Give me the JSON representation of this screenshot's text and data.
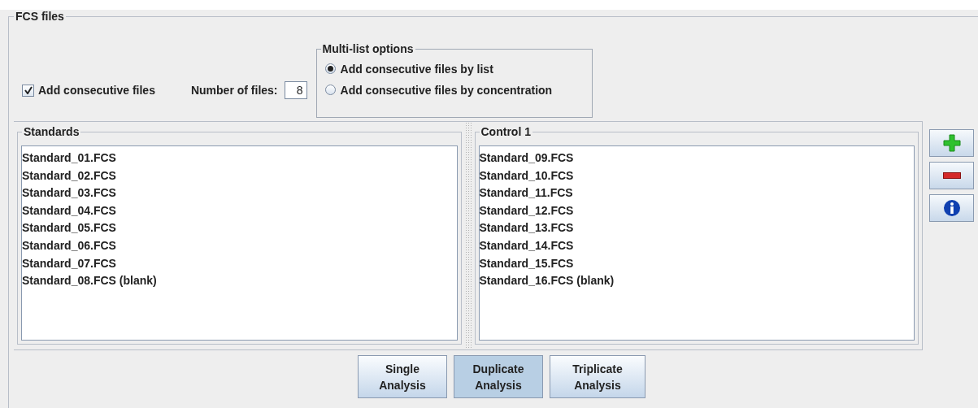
{
  "group": {
    "title": "FCS files"
  },
  "consecutive": {
    "label": "Add consecutive files",
    "checked": true
  },
  "number_of_files": {
    "label": "Number of files:",
    "value": "8"
  },
  "multi_list_options": {
    "title": "Multi-list options",
    "options": [
      {
        "label": "Add consecutive files by list",
        "selected": true
      },
      {
        "label": "Add consecutive files by concentration",
        "selected": false
      }
    ]
  },
  "lists": [
    {
      "title": "Standards",
      "items": [
        "Standard_01.FCS",
        "Standard_02.FCS",
        "Standard_03.FCS",
        "Standard_04.FCS",
        "Standard_05.FCS",
        "Standard_06.FCS",
        "Standard_07.FCS",
        "Standard_08.FCS (blank)"
      ]
    },
    {
      "title": "Control 1",
      "items": [
        "Standard_09.FCS",
        "Standard_10.FCS",
        "Standard_11.FCS",
        "Standard_12.FCS",
        "Standard_13.FCS",
        "Standard_14.FCS",
        "Standard_15.FCS",
        "Standard_16.FCS (blank)"
      ]
    }
  ],
  "side_buttons": [
    {
      "kind": "add"
    },
    {
      "kind": "remove"
    },
    {
      "kind": "info"
    }
  ],
  "analysis_buttons": [
    {
      "label": "Single\nAnalysis",
      "selected": false
    },
    {
      "label": "Duplicate\nAnalysis",
      "selected": true
    },
    {
      "label": "Triplicate\nAnalysis",
      "selected": false
    }
  ]
}
